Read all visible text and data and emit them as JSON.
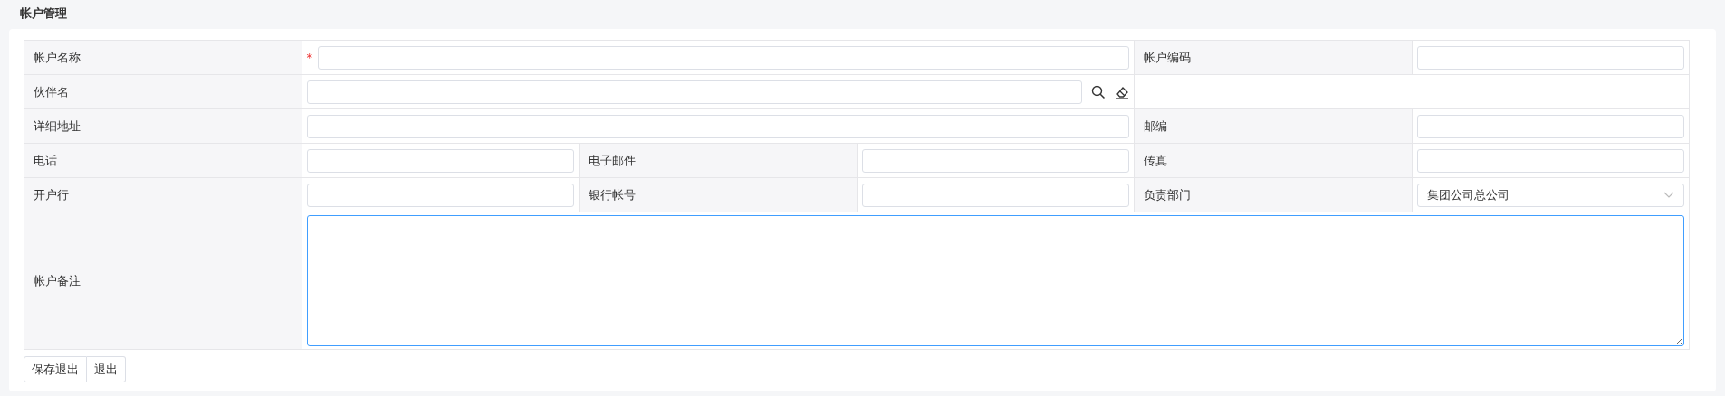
{
  "page": {
    "title": "帐户管理"
  },
  "form": {
    "rows": [
      {
        "fields": [
          {
            "label": "帐户名称",
            "kind": "input",
            "marker": "*",
            "focused": false
          },
          {
            "label": "帐户编码",
            "kind": "input",
            "focused": false
          }
        ]
      },
      {
        "fields": [
          {
            "label": "伙伴名",
            "kind": "lookup",
            "focused": false
          }
        ]
      },
      {
        "fields": [
          {
            "label": "详细地址",
            "kind": "input",
            "focused": false
          },
          {
            "label": "邮编",
            "kind": "input",
            "focused": false
          }
        ]
      },
      {
        "fields": [
          {
            "label": "电话",
            "kind": "input",
            "focused": false
          },
          {
            "label": "电子邮件",
            "kind": "input",
            "focused": false
          },
          {
            "label": "传真",
            "kind": "input",
            "focused": false
          }
        ]
      },
      {
        "fields": [
          {
            "label": "开户行",
            "kind": "input",
            "focused": false
          },
          {
            "label": "银行帐号",
            "kind": "input",
            "focused": false
          },
          {
            "label": "负责部门",
            "kind": "select",
            "value": "集团公司总公司",
            "focused": false
          }
        ]
      },
      {
        "fields": [
          {
            "label": "帐户备注",
            "kind": "textarea",
            "focused": true
          }
        ]
      }
    ]
  },
  "buttons": [
    "保存退出",
    "退出"
  ]
}
